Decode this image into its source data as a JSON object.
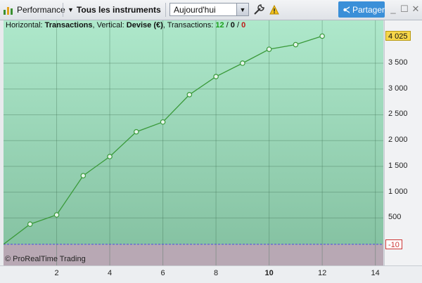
{
  "toolbar": {
    "performance_label": "Performance",
    "instruments_label": "Tous les instruments",
    "period_value": "Aujourd'hui",
    "share_label": "Partager"
  },
  "header": {
    "prefix": "Horizontal: ",
    "horizontal": "Transactions",
    "mid": ", Vertical: ",
    "vertical": "Devise (€)",
    "tx_label": ", Transactions: ",
    "tx_win": "12",
    "slash1": " / ",
    "tx_neutral": "0",
    "slash2": " / ",
    "tx_loss": "0"
  },
  "footer": {
    "copyright": "© ProRealTime Trading"
  },
  "tags": {
    "last_value": "4 025",
    "baseline_value": "-10"
  },
  "colors": {
    "panel_top": "#aee8cb",
    "panel_bottom": "#82bf9f",
    "negative_area": "#b8a8b4",
    "line": "#3a9a3a",
    "baseline": "#4b4be0",
    "tag_last": "#f6d64a"
  },
  "chart_data": {
    "type": "line",
    "x": [
      0,
      1,
      2,
      3,
      4,
      5,
      6,
      7,
      8,
      9,
      10,
      11,
      12
    ],
    "values": [
      -10,
      380,
      560,
      1320,
      1690,
      2170,
      2360,
      2890,
      3240,
      3500,
      3770,
      3860,
      4025
    ],
    "xlim": [
      0,
      14.3
    ],
    "ylim": [
      -420,
      4330
    ],
    "x_ticks": [
      "2",
      "4",
      "6",
      "8",
      "10",
      "12",
      "14"
    ],
    "x_tick_values": [
      2,
      4,
      6,
      8,
      10,
      12,
      14
    ],
    "y_ticks": [
      "500",
      "1 000",
      "1 500",
      "2 000",
      "2 500",
      "3 000",
      "3 500"
    ],
    "y_tick_values": [
      500,
      1000,
      1500,
      2000,
      2500,
      3000,
      3500
    ],
    "baseline": -10,
    "grid": true
  }
}
